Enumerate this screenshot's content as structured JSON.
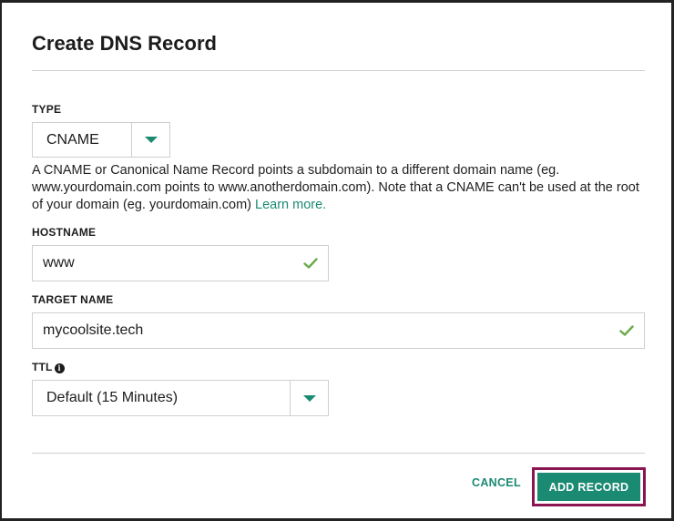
{
  "dialog": {
    "title": "Create DNS Record"
  },
  "type_field": {
    "label": "TYPE",
    "value": "CNAME",
    "description": "A CNAME or Canonical Name Record points a subdomain to a different domain name (eg. www.yourdomain.com points to www.anotherdomain.com). Note that a CNAME can't be used at the root of your domain (eg. yourdomain.com) ",
    "learn_more": "Learn more."
  },
  "hostname_field": {
    "label": "HOSTNAME",
    "value": "www",
    "valid_icon": "check-icon"
  },
  "target_field": {
    "label": "TARGET NAME",
    "value": "mycoolsite.tech",
    "valid_icon": "check-icon"
  },
  "ttl_field": {
    "label": "TTL",
    "info_icon": "info-icon",
    "value": "Default (15 Minutes)"
  },
  "actions": {
    "cancel_label": "CANCEL",
    "add_label": "ADD RECORD"
  },
  "colors": {
    "accent": "#1b8a73",
    "highlight_outline": "#8a1550",
    "check": "#6aaa4a",
    "border": "#cfcfcf"
  }
}
